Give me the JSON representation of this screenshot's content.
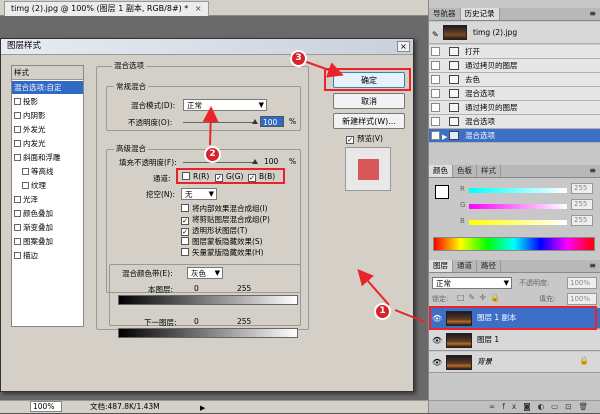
{
  "document": {
    "tab_title": "timg (2).jpg @ 100% (图层 1 副本, RGB/8#) *",
    "close": "×"
  },
  "status": {
    "zoom": "100%",
    "doc_info": "文档:487.8K/1.43M"
  },
  "dialog": {
    "title": "图层样式",
    "close": "×",
    "styles_header": "样式",
    "styles": [
      {
        "label": "混合选项:自定",
        "checkbox": false,
        "selected": true
      },
      {
        "label": "投影",
        "checkbox": true
      },
      {
        "label": "内阴影",
        "checkbox": true
      },
      {
        "label": "外发光",
        "checkbox": true
      },
      {
        "label": "内发光",
        "checkbox": true
      },
      {
        "label": "斜面和浮雕",
        "checkbox": true
      },
      {
        "label": "等高线",
        "checkbox": true,
        "indent": true
      },
      {
        "label": "纹理",
        "checkbox": true,
        "indent": true
      },
      {
        "label": "光泽",
        "checkbox": true
      },
      {
        "label": "颜色叠加",
        "checkbox": true
      },
      {
        "label": "渐变叠加",
        "checkbox": true
      },
      {
        "label": "图案叠加",
        "checkbox": true
      },
      {
        "label": "描边",
        "checkbox": true
      }
    ],
    "blend_options_title": "混合选项",
    "general": {
      "title": "常规混合",
      "mode_label": "混合模式(D):",
      "mode_value": "正常",
      "opacity_label": "不透明度(O):",
      "opacity_value": "100",
      "percent": "%"
    },
    "advanced": {
      "title": "高级混合",
      "fill_label": "填充不透明度(F):",
      "fill_value": "100",
      "percent": "%",
      "channels_label": "通道:",
      "channels": [
        {
          "label": "R(R)",
          "checked": false
        },
        {
          "label": "G(G)",
          "checked": true
        },
        {
          "label": "B(B)",
          "checked": true
        }
      ],
      "knockout_label": "挖空(N):",
      "knockout_value": "无",
      "options": [
        {
          "label": "将内部效果混合成组(I)",
          "checked": false
        },
        {
          "label": "将剪贴图层混合成组(P)",
          "checked": true
        },
        {
          "label": "透明形状图层(T)",
          "checked": true
        },
        {
          "label": "图层蒙板隐藏效果(S)",
          "checked": false
        },
        {
          "label": "矢量蒙版隐藏效果(H)",
          "checked": false
        }
      ]
    },
    "blend_if": {
      "label": "混合颜色带(E):",
      "value": "灰色",
      "this_layer_label": "本图层:",
      "this_min": "0",
      "this_max": "255",
      "under_layer_label": "下一图层:",
      "under_min": "0",
      "under_max": "255"
    },
    "buttons": {
      "ok": "确定",
      "cancel": "取消",
      "new_style": "新建样式(W)...",
      "preview": "预览(V)"
    },
    "preview_swatch_color": "#d9595a"
  },
  "callouts": [
    "1",
    "2",
    "3"
  ],
  "panels": {
    "history": {
      "tabs": [
        "导航器",
        "历史记录"
      ],
      "menu": "≡",
      "snapshot": "timg (2).jpg",
      "items": [
        {
          "label": "打开"
        },
        {
          "label": "通过拷贝的图层"
        },
        {
          "label": "去色"
        },
        {
          "label": "混合选项"
        },
        {
          "label": "通过拷贝的图层"
        },
        {
          "label": "混合选项"
        },
        {
          "label": "混合选项",
          "selected": true
        }
      ]
    },
    "color": {
      "tabs": [
        "颜色",
        "色板",
        "样式"
      ],
      "menu": "≡",
      "channels": [
        {
          "label": "R",
          "value": "255"
        },
        {
          "label": "G",
          "value": "255"
        },
        {
          "label": "B",
          "value": "255"
        }
      ]
    },
    "layers": {
      "tabs": [
        "图层",
        "通道",
        "路径"
      ],
      "menu": "≡",
      "mode": "正常",
      "opacity_label": "不透明度:",
      "opacity_value": "100%",
      "lock_label": "锁定:",
      "fill_label": "填充:",
      "fill_value": "100%",
      "items": [
        {
          "name": "图层 1 副本",
          "selected": true
        },
        {
          "name": "图层 1"
        },
        {
          "name": "背景",
          "locked": true
        }
      ],
      "footer_icons": [
        "link-icon",
        "fx-icon",
        "mask-icon",
        "adjustment-icon",
        "folder-icon",
        "new-layer-icon",
        "trash-icon"
      ]
    }
  }
}
